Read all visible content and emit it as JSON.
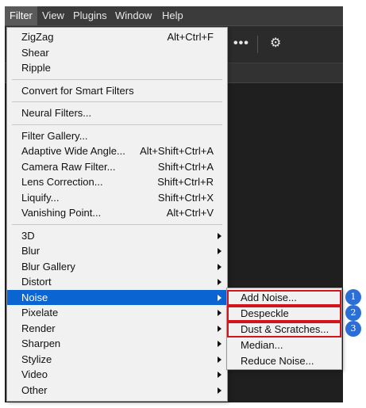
{
  "menubar": {
    "items": [
      "Filter",
      "View",
      "Plugins",
      "Window",
      "Help"
    ]
  },
  "toolbar": {
    "more_icon": "more-horizontal-icon",
    "settings_icon": "gear-icon"
  },
  "filter_menu": {
    "groups": [
      {
        "items": [
          {
            "label": "ZigZag",
            "shortcut": "Alt+Ctrl+F"
          },
          {
            "label": "Shear",
            "shortcut": ""
          },
          {
            "label": "Ripple",
            "shortcut": ""
          }
        ]
      },
      {
        "items": [
          {
            "label": "Convert for Smart Filters",
            "shortcut": ""
          }
        ]
      },
      {
        "items": [
          {
            "label": "Neural Filters...",
            "shortcut": ""
          }
        ]
      },
      {
        "items": [
          {
            "label": "Filter Gallery...",
            "shortcut": ""
          },
          {
            "label": "Adaptive Wide Angle...",
            "shortcut": "Alt+Shift+Ctrl+A"
          },
          {
            "label": "Camera Raw Filter...",
            "shortcut": "Shift+Ctrl+A"
          },
          {
            "label": "Lens Correction...",
            "shortcut": "Shift+Ctrl+R"
          },
          {
            "label": "Liquify...",
            "shortcut": "Shift+Ctrl+X"
          },
          {
            "label": "Vanishing Point...",
            "shortcut": "Alt+Ctrl+V"
          }
        ]
      },
      {
        "items": [
          {
            "label": "3D",
            "submenu": true
          },
          {
            "label": "Blur",
            "submenu": true
          },
          {
            "label": "Blur Gallery",
            "submenu": true
          },
          {
            "label": "Distort",
            "submenu": true
          },
          {
            "label": "Noise",
            "submenu": true,
            "highlighted": true
          },
          {
            "label": "Pixelate",
            "submenu": true
          },
          {
            "label": "Render",
            "submenu": true
          },
          {
            "label": "Sharpen",
            "submenu": true
          },
          {
            "label": "Stylize",
            "submenu": true
          },
          {
            "label": "Video",
            "submenu": true
          },
          {
            "label": "Other",
            "submenu": true
          }
        ]
      }
    ]
  },
  "noise_submenu": {
    "items": [
      {
        "label": "Add Noise...",
        "boxed": true,
        "badge": "1"
      },
      {
        "label": "Despeckle",
        "boxed": true,
        "badge": "2"
      },
      {
        "label": "Dust & Scratches...",
        "boxed": true,
        "badge": "3"
      },
      {
        "label": "Median...",
        "boxed": false
      },
      {
        "label": "Reduce Noise...",
        "boxed": false
      }
    ]
  },
  "colors": {
    "highlight": "#0a64d2",
    "callout_box": "#d4141c",
    "badge": "#2b6fd6"
  }
}
